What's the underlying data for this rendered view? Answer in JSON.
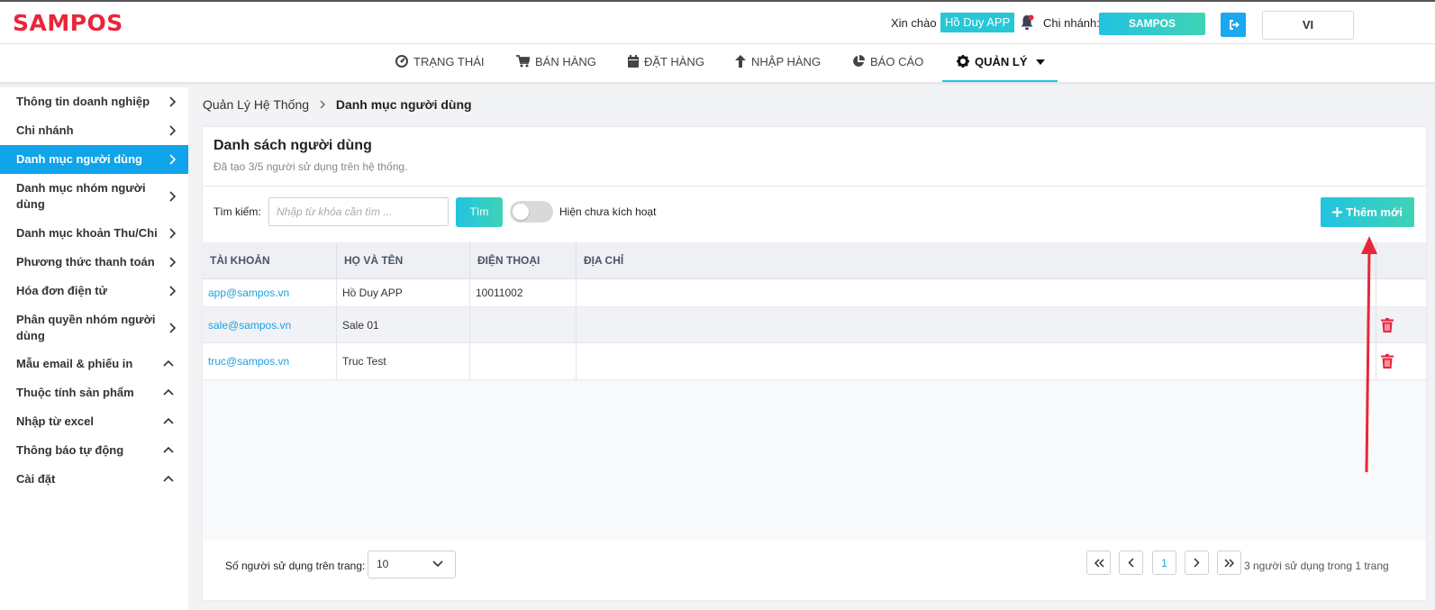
{
  "header": {
    "logo": "SAMPOS",
    "greeting": "Xin chào",
    "user_name": "Hồ Duy APP",
    "branch_label": "Chi nhánh:",
    "branch_name": "SAMPOS",
    "language": "VI"
  },
  "nav": {
    "items": [
      {
        "label": "TRẠNG THÁI",
        "icon": "dashboard-icon"
      },
      {
        "label": "BÁN HÀNG",
        "icon": "cart-icon"
      },
      {
        "label": "ĐẶT HÀNG",
        "icon": "calendar-icon"
      },
      {
        "label": "NHẬP HÀNG",
        "icon": "arrow-up-icon"
      },
      {
        "label": "BÁO CÁO",
        "icon": "pie-chart-icon"
      },
      {
        "label": "QUẢN LÝ",
        "icon": "gear-icon",
        "active": true
      }
    ]
  },
  "sidebar": {
    "items": [
      {
        "label": "Thông tin doanh nghiệp",
        "chevron": "right"
      },
      {
        "label": "Chi nhánh",
        "chevron": "right"
      },
      {
        "label": "Danh mục người dùng",
        "chevron": "right",
        "active": true
      },
      {
        "label": "Danh mục nhóm người dùng",
        "chevron": "right"
      },
      {
        "label": "Danh mục khoản Thu/Chi",
        "chevron": "right"
      },
      {
        "label": "Phương thức thanh toán",
        "chevron": "right"
      },
      {
        "label": "Hóa đơn điện tử",
        "chevron": "right"
      },
      {
        "label": "Phân quyền nhóm người dùng",
        "chevron": "right"
      },
      {
        "label": "Mẫu email & phiếu in",
        "chevron": "up"
      },
      {
        "label": "Thuộc tính sản phẩm",
        "chevron": "up"
      },
      {
        "label": "Nhập từ excel",
        "chevron": "up"
      },
      {
        "label": "Thông báo tự động",
        "chevron": "up"
      },
      {
        "label": "Cài đặt",
        "chevron": "up"
      }
    ]
  },
  "breadcrumb": {
    "parent": "Quản Lý Hệ Thống",
    "current": "Danh mục người dùng"
  },
  "main": {
    "title": "Danh sách người dùng",
    "subtitle": "Đã tạo 3/5 người sử dụng trên hệ thống.",
    "search_label": "Tìm kiếm:",
    "search_placeholder": "Nhập từ khóa cần tìm ...",
    "search_value": "",
    "search_button": "Tìm",
    "toggle_label": "Hiện chưa kích hoạt",
    "toggle_on": false,
    "add_button": "Thêm mới"
  },
  "table": {
    "columns": [
      "TÀI KHOẢN",
      "HỌ VÀ TÊN",
      "ĐIỆN THOẠI",
      "ĐỊA CHỈ"
    ],
    "rows": [
      {
        "account": "app@sampos.vn",
        "name": "Hồ Duy APP",
        "phone": "10011002",
        "address": "",
        "deletable": false
      },
      {
        "account": "sale@sampos.vn",
        "name": "Sale 01",
        "phone": "",
        "address": "",
        "deletable": true
      },
      {
        "account": "truc@sampos.vn",
        "name": "Truc Test",
        "phone": "",
        "address": "",
        "deletable": true
      }
    ]
  },
  "footer": {
    "per_page_label": "Số người sử dụng trên trang:",
    "per_page_value": "10",
    "current_page": "1",
    "summary": "3 người sử dụng trong 1 trang"
  },
  "colors": {
    "brand": "#e8263a",
    "accent": "#22c3e0",
    "sidebar_active": "#10a4ea",
    "link": "#1ba1e2",
    "delete": "#e8263a"
  }
}
